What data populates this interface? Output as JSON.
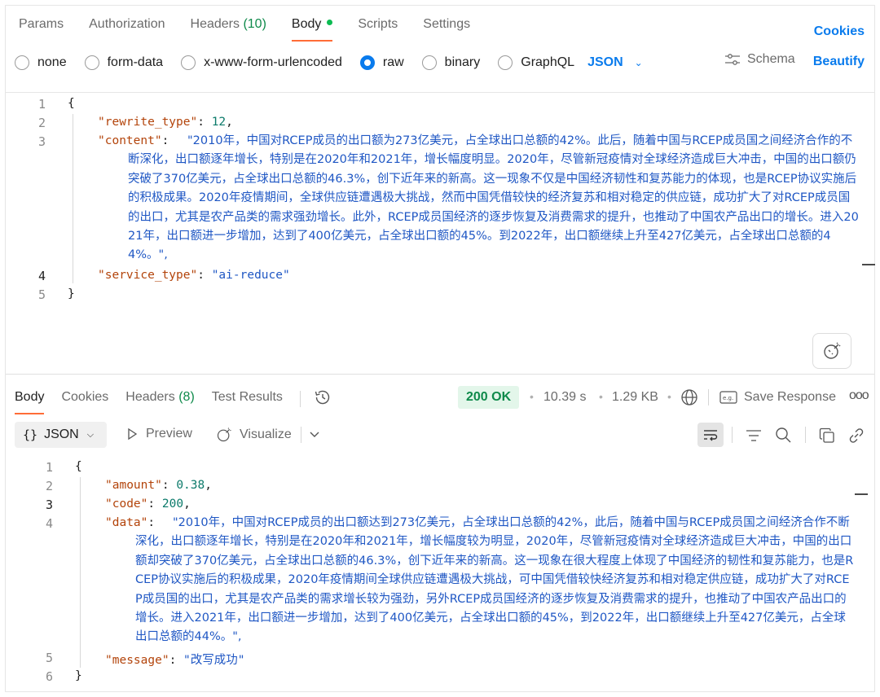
{
  "request": {
    "tabs": [
      {
        "label": "Params"
      },
      {
        "label": "Authorization"
      },
      {
        "label": "Headers",
        "count": "(10)"
      },
      {
        "label": "Body"
      },
      {
        "label": "Scripts"
      },
      {
        "label": "Settings"
      }
    ],
    "cookies_label": "Cookies",
    "body_modes": [
      "none",
      "form-data",
      "x-www-form-urlencoded",
      "raw",
      "binary",
      "GraphQL"
    ],
    "selected_mode": "raw",
    "format": "JSON",
    "schema_label": "Schema",
    "beautify_label": "Beautify",
    "line_numbers": [
      "1",
      "2",
      "3",
      "4",
      "5"
    ],
    "code": {
      "open": "{",
      "k1": "\"rewrite_type\"",
      "v1": "12",
      "k2": "\"content\"",
      "v2": "\"2010年，中国对RCEP成员的出口额为273亿美元，占全球出口总额的42%。此后，随着中国与RCEP成员国之间经济合作的不断深化，出口额逐年增长，特别是在2020年和2021年，增长幅度明显。2020年，尽管新冠疫情对全球经济造成巨大冲击，中国的出口额仍突破了370亿美元，占全球出口总额的46.3%，创下近年来的新高。这一现象不仅是中国经济韧性和复苏能力的体现，也是RCEP协议实施后的积极成果。2020年疫情期间，全球供应链遭遇极大挑战，然而中国凭借较快的经济复苏和相对稳定的供应链，成功扩大了对RCEP成员国的出口，尤其是农产品类的需求强劲增长。此外，RCEP成员国经济的逐步恢复及消费需求的提升，也推动了中国农产品出口的增长。进入2021年，出口额进一步增加，达到了400亿美元，占全球出口额的45%。到2022年，出口额继续上升至427亿美元，占全球出口总额的44%。\"",
      "k3": "\"service_type\"",
      "v3": "\"ai-reduce\"",
      "close": "}"
    }
  },
  "response": {
    "tabs": [
      {
        "label": "Body"
      },
      {
        "label": "Cookies"
      },
      {
        "label": "Headers",
        "count": "(8)"
      },
      {
        "label": "Test Results"
      }
    ],
    "status": "200 OK",
    "time": "10.39 s",
    "size": "1.29 KB",
    "save_label": "Save Response",
    "more": "ooo",
    "format": "JSON",
    "preview_label": "Preview",
    "visualize_label": "Visualize",
    "line_numbers": [
      "1",
      "2",
      "3",
      "4",
      "5",
      "6"
    ],
    "code": {
      "open": "{",
      "k1": "\"amount\"",
      "v1": "0.38",
      "k2": "\"code\"",
      "v2": "200",
      "k3": "\"data\"",
      "v3": "\"2010年，中国对RCEP成员的出口额达到273亿美元，占全球出口总额的42%，此后，随着中国与RCEP成员国之间经济合作不断深化，出口额逐年增长，特别是在2020年和2021年，增长幅度较为明显，2020年，尽管新冠疫情对全球经济造成巨大冲击，中国的出口额却突破了370亿美元，占全球出口总额的46.3%，创下近年来的新高。这一现象在很大程度上体现了中国经济的韧性和复苏能力，也是RCEP协议实施后的积极成果，2020年疫情期间全球供应链遭遇极大挑战，可中国凭借较快经济复苏和相对稳定供应链，成功扩大了对RCEP成员国的出口，尤其是农产品类的需求增长较为强劲，另外RCEP成员国经济的逐步恢复及消费需求的提升，也推动了中国农产品出口的增长。进入2021年，出口额进一步增加，达到了400亿美元，占全球出口额的45%，到2022年，出口额继续上升至427亿美元，占全球出口总额的44%。\"",
      "k4": "\"message\"",
      "v4": "\"改写成功\"",
      "close": "}"
    }
  }
}
